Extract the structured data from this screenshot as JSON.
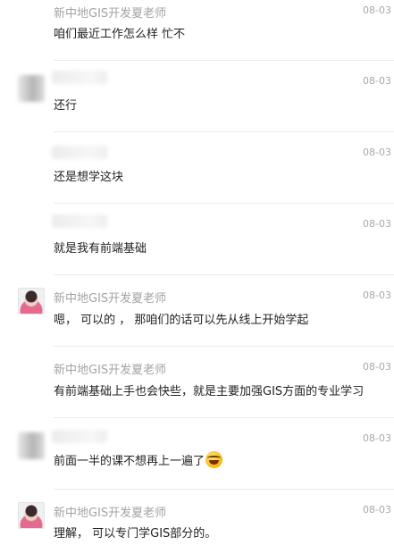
{
  "messages": [
    {
      "sender": "新中地GIS开发夏老师",
      "time": "08-03 (",
      "text": "咱们最近工作怎么样  忙不",
      "avatar": "none"
    },
    {
      "sender": "",
      "time": "08-03 (",
      "text": "还行",
      "avatar": "blurred"
    },
    {
      "sender": "",
      "time": "08-03 (",
      "text": "还是想学这块",
      "avatar": "none"
    },
    {
      "sender": "",
      "time": "08-03 (",
      "text": "就是我有前端基础",
      "avatar": "none"
    },
    {
      "sender": "新中地GIS开发夏老师",
      "time": "08-03 (",
      "text": "嗯，  可以的 ，  那咱们的话可以先从线上开始学起",
      "avatar": "photo"
    },
    {
      "sender": "新中地GIS开发夏老师",
      "time": "08-03 (",
      "text": "有前端基础上手也会快些，就是主要加强GIS方面的专业学习",
      "avatar": "none"
    },
    {
      "sender": "",
      "time": "08-03 (",
      "text": "前面一半的课不想再上一遍了",
      "avatar": "blurred",
      "emoji": "laughing-tears-emoji"
    },
    {
      "sender": "新中地GIS开发夏老师",
      "time": "08-03 (",
      "text": "理解，  可以专门学GIS部分的。",
      "avatar": "photo"
    }
  ]
}
